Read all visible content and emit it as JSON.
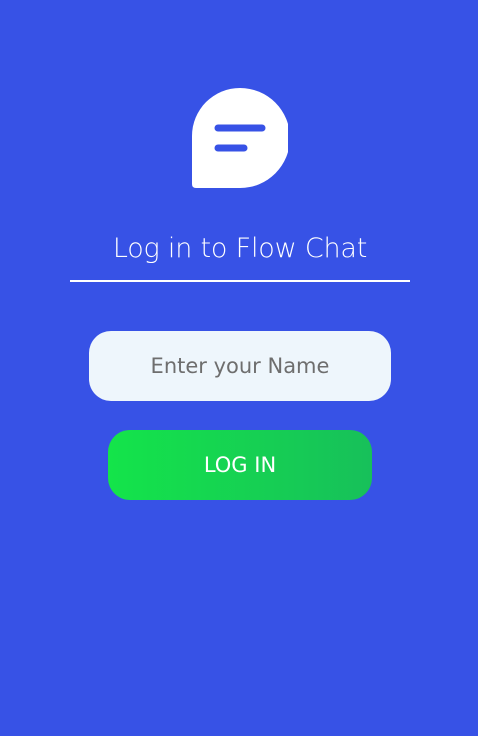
{
  "logo": {
    "icon": "chat-bubble-icon",
    "bubble_color": "#ffffff",
    "line_color": "#3752e6"
  },
  "login": {
    "title": "Log in to Flow Chat",
    "name_placeholder": "Enter your Name",
    "name_value": "",
    "button_label": "LOG IN"
  },
  "colors": {
    "background": "#3752e6",
    "input_background": "#eef6fc",
    "button_gradient_start": "#14e44a",
    "button_gradient_end": "#17c05a"
  }
}
